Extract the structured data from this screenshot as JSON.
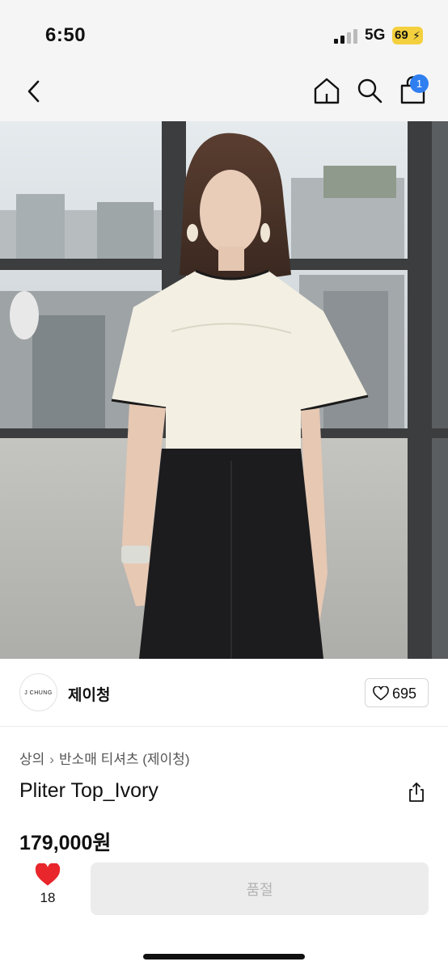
{
  "status_bar": {
    "time": "6:50",
    "network": "5G",
    "battery": "69"
  },
  "header": {
    "back_icon": "chevron-left-icon",
    "home_icon": "home-icon",
    "search_icon": "search-icon",
    "cart_icon": "shopping-bag-icon",
    "cart_badge": "1",
    "badge_color": "#2f7ff0"
  },
  "product_image": {
    "alt": "제이청 Pliter Top_Ivory"
  },
  "brand": {
    "logo_text": "J CHUNG",
    "name": "제이청",
    "like_icon": "heart-outline-icon",
    "likes": "695"
  },
  "product": {
    "breadcrumb": [
      "상의",
      "반소매 티셔츠 (제이청)"
    ],
    "title": "Pliter Top_Ivory",
    "share_icon": "share-icon",
    "price": "179,000원"
  },
  "actions": {
    "wish_icon": "heart-filled-icon",
    "wish_color": "#e8262b",
    "wish_count": "18",
    "soldout_label": "품절"
  }
}
